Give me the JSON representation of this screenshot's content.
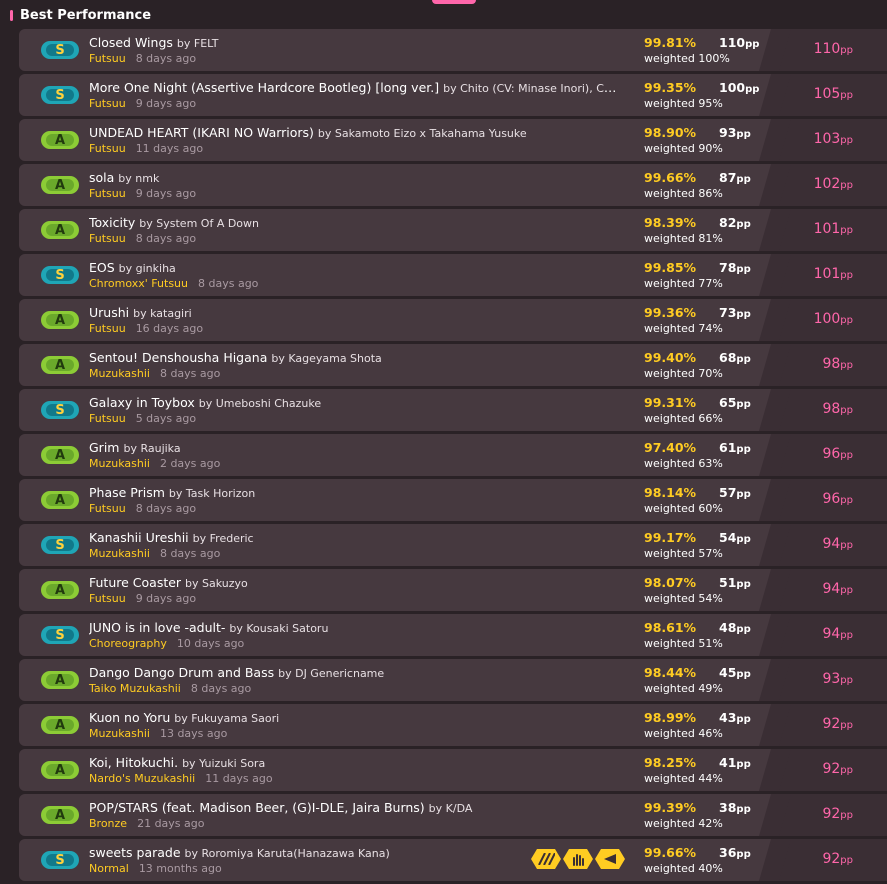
{
  "section": {
    "title": "Best Performance"
  },
  "labels": {
    "by": "by",
    "pp_unit": "pp",
    "weighted": "weighted"
  },
  "colors": {
    "accent": "#ff66aa",
    "accuracy": "#ffcc22",
    "grade_s": "#1fa6b6",
    "grade_a": "#8ccc36"
  },
  "scores": [
    {
      "grade": "S",
      "title": "Closed Wings",
      "artist": "FELT",
      "difficulty": "Futsuu",
      "ago": "8 days ago",
      "accuracy": "99.81%",
      "raw_pp": "110",
      "weighted": "weighted 100%",
      "pp": "110",
      "mods": []
    },
    {
      "grade": "S",
      "title": "More One Night (Assertive Hardcore Bootleg) [long ver.]",
      "artist": "Chito (CV: Minase Inori), Chito (CV: Minase Inori)",
      "difficulty": "Futsuu",
      "ago": "9 days ago",
      "accuracy": "99.35%",
      "raw_pp": "100",
      "weighted": "weighted 95%",
      "pp": "105",
      "mods": []
    },
    {
      "grade": "A",
      "title": "UNDEAD HEART (IKARI NO Warriors)",
      "artist": "Sakamoto Eizo x Takahama Yusuke",
      "difficulty": "Futsuu",
      "ago": "11 days ago",
      "accuracy": "98.90%",
      "raw_pp": "93",
      "weighted": "weighted 90%",
      "pp": "103",
      "mods": []
    },
    {
      "grade": "A",
      "title": "sola",
      "artist": "nmk",
      "difficulty": "Futsuu",
      "ago": "9 days ago",
      "accuracy": "99.66%",
      "raw_pp": "87",
      "weighted": "weighted 86%",
      "pp": "102",
      "mods": []
    },
    {
      "grade": "A",
      "title": "Toxicity",
      "artist": "System Of A Down",
      "difficulty": "Futsuu",
      "ago": "8 days ago",
      "accuracy": "98.39%",
      "raw_pp": "82",
      "weighted": "weighted 81%",
      "pp": "101",
      "mods": []
    },
    {
      "grade": "S",
      "title": "EOS",
      "artist": "ginkiha",
      "difficulty": "Chromoxx' Futsuu",
      "ago": "8 days ago",
      "accuracy": "99.85%",
      "raw_pp": "78",
      "weighted": "weighted 77%",
      "pp": "101",
      "mods": []
    },
    {
      "grade": "A",
      "title": "Urushi",
      "artist": "katagiri",
      "difficulty": "Futsuu",
      "ago": "16 days ago",
      "accuracy": "99.36%",
      "raw_pp": "73",
      "weighted": "weighted 74%",
      "pp": "100",
      "mods": []
    },
    {
      "grade": "A",
      "title": "Sentou! Denshousha Higana",
      "artist": "Kageyama Shota",
      "difficulty": "Muzukashii",
      "ago": "8 days ago",
      "accuracy": "99.40%",
      "raw_pp": "68",
      "weighted": "weighted 70%",
      "pp": "98",
      "mods": []
    },
    {
      "grade": "S",
      "title": "Galaxy in Toybox",
      "artist": "Umeboshi Chazuke",
      "difficulty": "Futsuu",
      "ago": "5 days ago",
      "accuracy": "99.31%",
      "raw_pp": "65",
      "weighted": "weighted 66%",
      "pp": "98",
      "mods": []
    },
    {
      "grade": "A",
      "title": "Grim",
      "artist": "Raujika",
      "difficulty": "Muzukashii",
      "ago": "2 days ago",
      "accuracy": "97.40%",
      "raw_pp": "61",
      "weighted": "weighted 63%",
      "pp": "96",
      "mods": []
    },
    {
      "grade": "A",
      "title": "Phase Prism",
      "artist": "Task Horizon",
      "difficulty": "Futsuu",
      "ago": "8 days ago",
      "accuracy": "98.14%",
      "raw_pp": "57",
      "weighted": "weighted 60%",
      "pp": "96",
      "mods": []
    },
    {
      "grade": "S",
      "title": "Kanashii Ureshii",
      "artist": "Frederic",
      "difficulty": "Muzukashii",
      "ago": "8 days ago",
      "accuracy": "99.17%",
      "raw_pp": "54",
      "weighted": "weighted 57%",
      "pp": "94",
      "mods": []
    },
    {
      "grade": "A",
      "title": "Future Coaster",
      "artist": "Sakuzyo",
      "difficulty": "Futsuu",
      "ago": "9 days ago",
      "accuracy": "98.07%",
      "raw_pp": "51",
      "weighted": "weighted 54%",
      "pp": "94",
      "mods": []
    },
    {
      "grade": "S",
      "title": "JUNO is in love -adult-",
      "artist": "Kousaki Satoru",
      "difficulty": "Choreography",
      "ago": "10 days ago",
      "accuracy": "98.61%",
      "raw_pp": "48",
      "weighted": "weighted 51%",
      "pp": "94",
      "mods": []
    },
    {
      "grade": "A",
      "title": "Dango Dango Drum and Bass",
      "artist": "DJ Genericname",
      "difficulty": "Taiko Muzukashii",
      "ago": "8 days ago",
      "accuracy": "98.44%",
      "raw_pp": "45",
      "weighted": "weighted 49%",
      "pp": "93",
      "mods": []
    },
    {
      "grade": "A",
      "title": "Kuon no Yoru",
      "artist": "Fukuyama Saori",
      "difficulty": "Muzukashii",
      "ago": "13 days ago",
      "accuracy": "98.99%",
      "raw_pp": "43",
      "weighted": "weighted 46%",
      "pp": "92",
      "mods": []
    },
    {
      "grade": "A",
      "title": "Koi, Hitokuchi.",
      "artist": "Yuizuki Sora",
      "difficulty": "Nardo's Muzukashii",
      "ago": "11 days ago",
      "accuracy": "98.25%",
      "raw_pp": "41",
      "weighted": "weighted 44%",
      "pp": "92",
      "mods": []
    },
    {
      "grade": "A",
      "title": "POP/STARS (feat. Madison Beer, (G)I-DLE, Jaira Burns)",
      "artist": "K/DA",
      "difficulty": "Bronze",
      "ago": "21 days ago",
      "accuracy": "99.39%",
      "raw_pp": "38",
      "weighted": "weighted 42%",
      "pp": "92",
      "mods": []
    },
    {
      "grade": "S",
      "title": "sweets parade",
      "artist": "Roromiya Karuta(Hanazawa Kana)",
      "difficulty": "Normal",
      "ago": "13 months ago",
      "accuracy": "99.66%",
      "raw_pp": "36",
      "weighted": "weighted 40%",
      "pp": "92",
      "mods": [
        "stripes-icon",
        "hand-icon",
        "flashlight-icon"
      ]
    }
  ]
}
